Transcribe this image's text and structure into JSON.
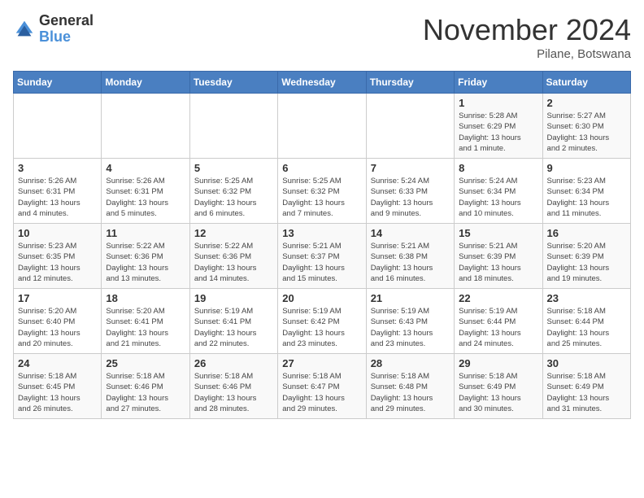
{
  "logo": {
    "general": "General",
    "blue": "Blue"
  },
  "header": {
    "month": "November 2024",
    "location": "Pilane, Botswana"
  },
  "weekdays": [
    "Sunday",
    "Monday",
    "Tuesday",
    "Wednesday",
    "Thursday",
    "Friday",
    "Saturday"
  ],
  "weeks": [
    [
      {
        "day": "",
        "info": ""
      },
      {
        "day": "",
        "info": ""
      },
      {
        "day": "",
        "info": ""
      },
      {
        "day": "",
        "info": ""
      },
      {
        "day": "",
        "info": ""
      },
      {
        "day": "1",
        "info": "Sunrise: 5:28 AM\nSunset: 6:29 PM\nDaylight: 13 hours\nand 1 minute."
      },
      {
        "day": "2",
        "info": "Sunrise: 5:27 AM\nSunset: 6:30 PM\nDaylight: 13 hours\nand 2 minutes."
      }
    ],
    [
      {
        "day": "3",
        "info": "Sunrise: 5:26 AM\nSunset: 6:31 PM\nDaylight: 13 hours\nand 4 minutes."
      },
      {
        "day": "4",
        "info": "Sunrise: 5:26 AM\nSunset: 6:31 PM\nDaylight: 13 hours\nand 5 minutes."
      },
      {
        "day": "5",
        "info": "Sunrise: 5:25 AM\nSunset: 6:32 PM\nDaylight: 13 hours\nand 6 minutes."
      },
      {
        "day": "6",
        "info": "Sunrise: 5:25 AM\nSunset: 6:32 PM\nDaylight: 13 hours\nand 7 minutes."
      },
      {
        "day": "7",
        "info": "Sunrise: 5:24 AM\nSunset: 6:33 PM\nDaylight: 13 hours\nand 9 minutes."
      },
      {
        "day": "8",
        "info": "Sunrise: 5:24 AM\nSunset: 6:34 PM\nDaylight: 13 hours\nand 10 minutes."
      },
      {
        "day": "9",
        "info": "Sunrise: 5:23 AM\nSunset: 6:34 PM\nDaylight: 13 hours\nand 11 minutes."
      }
    ],
    [
      {
        "day": "10",
        "info": "Sunrise: 5:23 AM\nSunset: 6:35 PM\nDaylight: 13 hours\nand 12 minutes."
      },
      {
        "day": "11",
        "info": "Sunrise: 5:22 AM\nSunset: 6:36 PM\nDaylight: 13 hours\nand 13 minutes."
      },
      {
        "day": "12",
        "info": "Sunrise: 5:22 AM\nSunset: 6:36 PM\nDaylight: 13 hours\nand 14 minutes."
      },
      {
        "day": "13",
        "info": "Sunrise: 5:21 AM\nSunset: 6:37 PM\nDaylight: 13 hours\nand 15 minutes."
      },
      {
        "day": "14",
        "info": "Sunrise: 5:21 AM\nSunset: 6:38 PM\nDaylight: 13 hours\nand 16 minutes."
      },
      {
        "day": "15",
        "info": "Sunrise: 5:21 AM\nSunset: 6:39 PM\nDaylight: 13 hours\nand 18 minutes."
      },
      {
        "day": "16",
        "info": "Sunrise: 5:20 AM\nSunset: 6:39 PM\nDaylight: 13 hours\nand 19 minutes."
      }
    ],
    [
      {
        "day": "17",
        "info": "Sunrise: 5:20 AM\nSunset: 6:40 PM\nDaylight: 13 hours\nand 20 minutes."
      },
      {
        "day": "18",
        "info": "Sunrise: 5:20 AM\nSunset: 6:41 PM\nDaylight: 13 hours\nand 21 minutes."
      },
      {
        "day": "19",
        "info": "Sunrise: 5:19 AM\nSunset: 6:41 PM\nDaylight: 13 hours\nand 22 minutes."
      },
      {
        "day": "20",
        "info": "Sunrise: 5:19 AM\nSunset: 6:42 PM\nDaylight: 13 hours\nand 23 minutes."
      },
      {
        "day": "21",
        "info": "Sunrise: 5:19 AM\nSunset: 6:43 PM\nDaylight: 13 hours\nand 23 minutes."
      },
      {
        "day": "22",
        "info": "Sunrise: 5:19 AM\nSunset: 6:44 PM\nDaylight: 13 hours\nand 24 minutes."
      },
      {
        "day": "23",
        "info": "Sunrise: 5:18 AM\nSunset: 6:44 PM\nDaylight: 13 hours\nand 25 minutes."
      }
    ],
    [
      {
        "day": "24",
        "info": "Sunrise: 5:18 AM\nSunset: 6:45 PM\nDaylight: 13 hours\nand 26 minutes."
      },
      {
        "day": "25",
        "info": "Sunrise: 5:18 AM\nSunset: 6:46 PM\nDaylight: 13 hours\nand 27 minutes."
      },
      {
        "day": "26",
        "info": "Sunrise: 5:18 AM\nSunset: 6:46 PM\nDaylight: 13 hours\nand 28 minutes."
      },
      {
        "day": "27",
        "info": "Sunrise: 5:18 AM\nSunset: 6:47 PM\nDaylight: 13 hours\nand 29 minutes."
      },
      {
        "day": "28",
        "info": "Sunrise: 5:18 AM\nSunset: 6:48 PM\nDaylight: 13 hours\nand 29 minutes."
      },
      {
        "day": "29",
        "info": "Sunrise: 5:18 AM\nSunset: 6:49 PM\nDaylight: 13 hours\nand 30 minutes."
      },
      {
        "day": "30",
        "info": "Sunrise: 5:18 AM\nSunset: 6:49 PM\nDaylight: 13 hours\nand 31 minutes."
      }
    ]
  ]
}
